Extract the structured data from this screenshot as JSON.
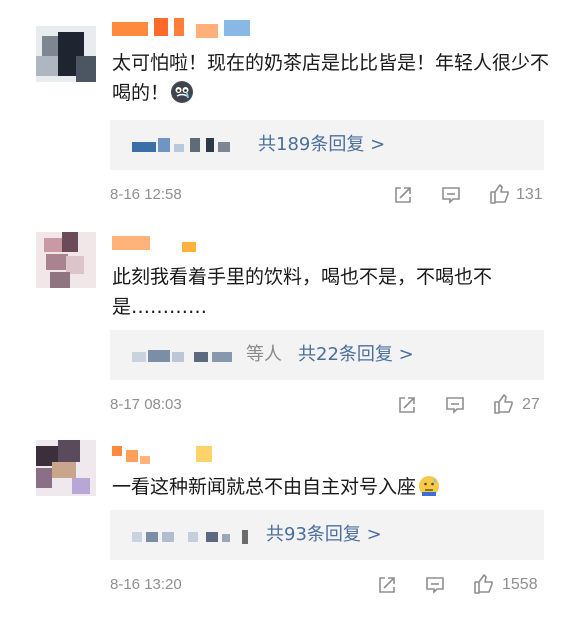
{
  "comments": [
    {
      "text": "太可怕啦！现在的奶茶店是比比皆是！年轻人很少不喝的！",
      "emoji": "crying-emoji",
      "others_label": "",
      "reply_label": "共189条回复 >",
      "date": "8-16 12:58",
      "likes": "131"
    },
    {
      "text": "此刻我看着手里的饮料，喝也不是，不喝也不是…………",
      "emoji": "",
      "others_label": "等人",
      "reply_label": "共22条回复 >",
      "date": "8-17 08:03",
      "likes": "27"
    },
    {
      "text": "一看这种新闻就总不由自主对号入座",
      "emoji": "sweat-emoji",
      "others_label": "",
      "reply_label": "共93条回复 >",
      "date": "8-16 13:20",
      "likes": "1558"
    }
  ],
  "icons": {
    "share": "share-icon",
    "comment": "comment-icon",
    "like": "thumbs-up-icon"
  },
  "colors": {
    "link": "#4a6f9c",
    "meta": "#8f8f8f",
    "reply_bg": "#f3f3f3"
  }
}
